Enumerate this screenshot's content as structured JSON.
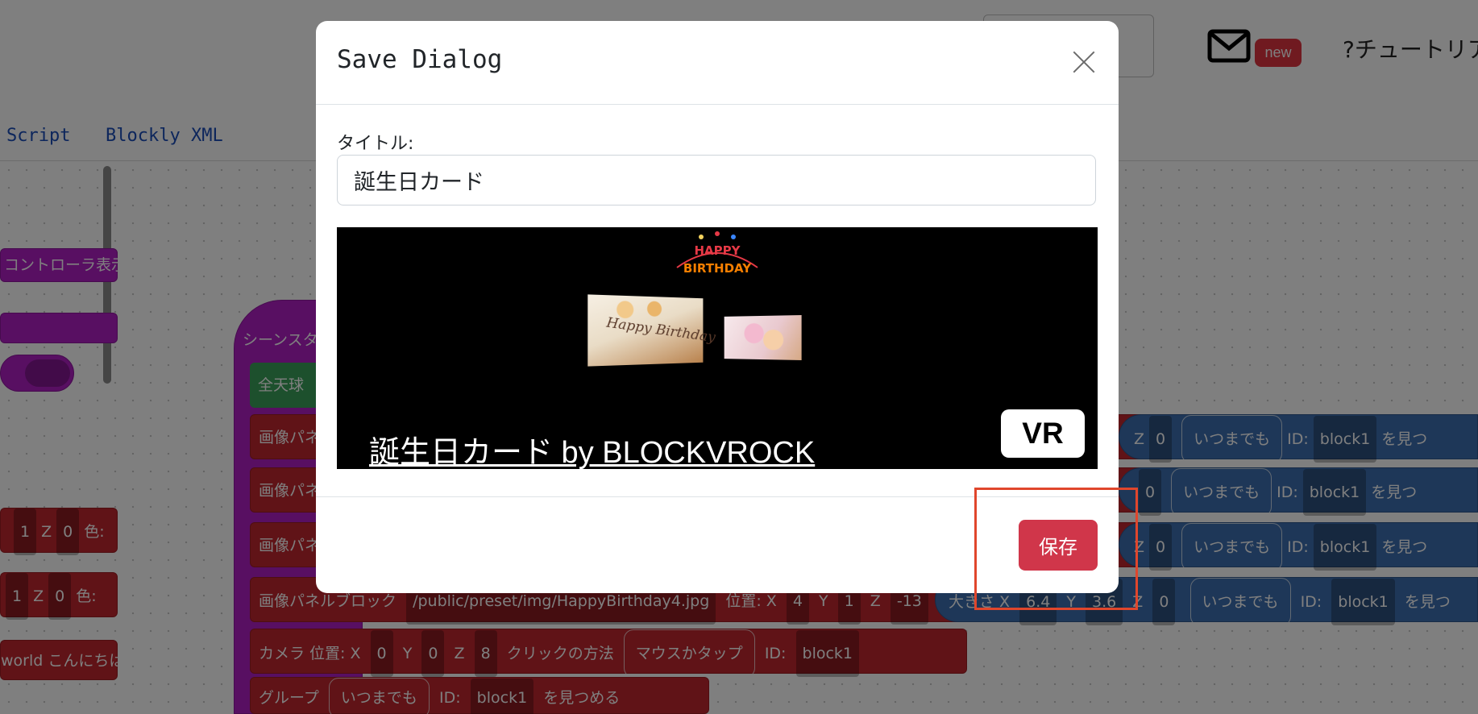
{
  "colors": {
    "accent_red": "#d0364a",
    "highlight": "#e0462c",
    "link_blue": "#1a4db8",
    "block_purple": "#b11fc4",
    "block_red": "#c0262e",
    "block_blue": "#3d6fb0"
  },
  "header": {
    "mail_icon": "envelope-icon",
    "new_badge": "new",
    "tutorial_label": "?チュートリア"
  },
  "tabs": [
    "Script",
    "Blockly XML"
  ],
  "background_blocks": {
    "controller_label": "コントローラ表示",
    "scene_start": "シーンスター",
    "sky_label": "全天球",
    "image_panel_short": "画像パネル",
    "image_panel_short_2": "画像パネル",
    "image_panel_short_3": "画像パネル",
    "image_panel_full": "画像パネルブロック",
    "image_path": "/public/preset/img/HappyBirthday4.jpg",
    "position_label": "位置: X",
    "pos_x": "4",
    "y_label": "Y",
    "pos_y": "1",
    "z_label": "Z",
    "pos_z": "-13",
    "size_label": "大きさ X",
    "size_x": "6.4",
    "size_y": "3.6",
    "size_z": "0",
    "camera_label": "カメラ 位置: X",
    "cam_x": "0",
    "cam_y": "0",
    "cam_z": "8",
    "click_method_label": "クリックの方法",
    "click_method": "マウスかタップ",
    "id_label": "ID:",
    "id_value": "block1",
    "group_label": "グループ",
    "forever": "いつまでも",
    "look_at": "を見つめる",
    "look_at_short": "を見つ",
    "hello_world": "world こんにちは",
    "color_label": "色:",
    "one": "1",
    "zero": "0"
  },
  "dialog": {
    "title": "Save Dialog",
    "close_icon": "close-icon",
    "title_field_label": "タイトル:",
    "title_field_value": "誕生日カード",
    "preview": {
      "logo_text": "HAPPY BIRTHDAY",
      "photo_text": "Happy Birthday",
      "link_text": "誕生日カード by BLOCKVROCK",
      "vr_badge": "VR"
    },
    "save_button": "保存"
  }
}
